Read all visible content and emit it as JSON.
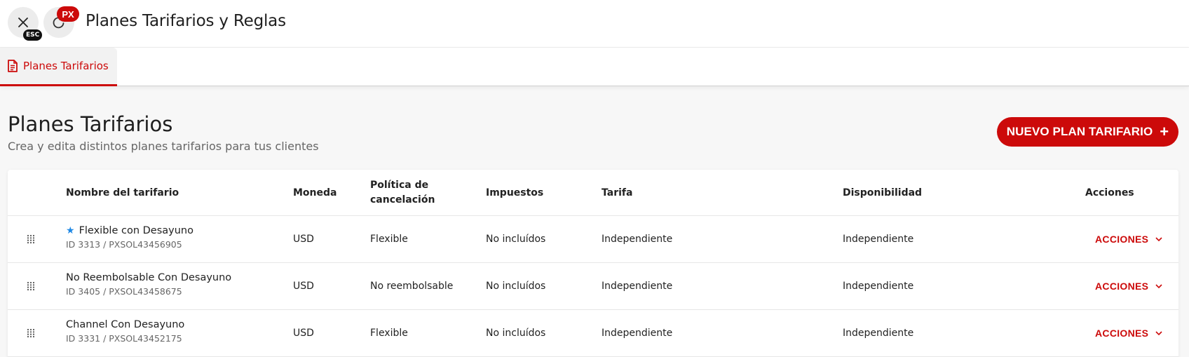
{
  "header": {
    "title": "Planes Tarifarios y Reglas",
    "esc_badge": "ESC",
    "px_badge": "PX"
  },
  "tabs": [
    {
      "label": "Planes Tarifarios",
      "icon": "document-icon",
      "active": true
    }
  ],
  "section": {
    "title": "Planes Tarifarios",
    "subtitle": "Crea y edita distintos planes tarifarios para tus clientes",
    "new_button_label": "NUEVO PLAN TARIFARIO"
  },
  "table": {
    "columns": {
      "name": "Nombre del tarifario",
      "currency": "Moneda",
      "policy_line1": "Política de",
      "policy_line2": "cancelación",
      "taxes": "Impuestos",
      "rate": "Tarifa",
      "availability": "Disponibilidad",
      "actions": "Acciones"
    },
    "rows": [
      {
        "name": "Flexible con Desayuno",
        "starred": true,
        "id": "ID 3313 / PXSOL43456905",
        "currency": "USD",
        "policy": "Flexible",
        "taxes": "No incluídos",
        "rate": "Independiente",
        "availability": "Independiente",
        "actions_label": "ACCIONES"
      },
      {
        "name": "No Reembolsable Con Desayuno",
        "starred": false,
        "id": "ID 3405 / PXSOL43458675",
        "currency": "USD",
        "policy": "No reembolsable",
        "taxes": "No incluídos",
        "rate": "Independiente",
        "availability": "Independiente",
        "actions_label": "ACCIONES"
      },
      {
        "name": "Channel Con Desayuno",
        "starred": false,
        "id": "ID 3331 / PXSOL43452175",
        "currency": "USD",
        "policy": "Flexible",
        "taxes": "No incluídos",
        "rate": "Independiente",
        "availability": "Independiente",
        "actions_label": "ACCIONES"
      }
    ]
  },
  "colors": {
    "accent": "#cc0a0a",
    "star": "#1e88e5"
  }
}
